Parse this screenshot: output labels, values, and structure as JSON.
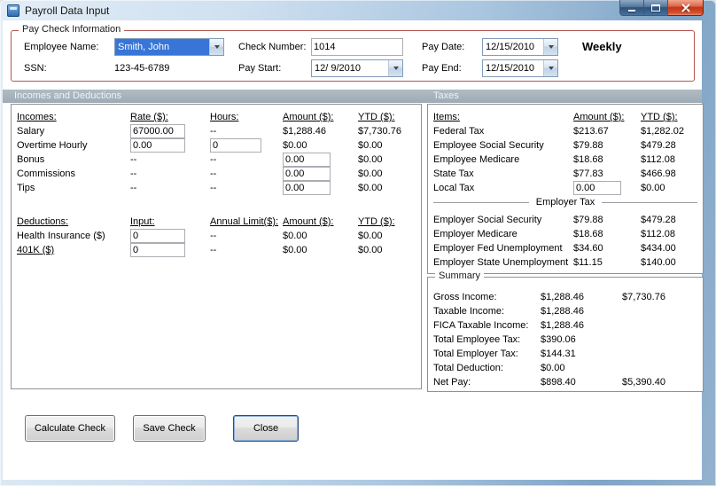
{
  "window": {
    "title": "Payroll Data Input"
  },
  "colors": {
    "group_border": "#b25653",
    "selection_blue": "#3875d7",
    "section_bar": "#a5b1ba",
    "close_button_red": "#c23516"
  },
  "header": {
    "group_title": "Pay Check Information",
    "fields": {
      "employee_name": {
        "label": "Employee Name:",
        "value": "Smith, John"
      },
      "ssn": {
        "label": "SSN:",
        "value": "123-45-6789"
      },
      "check_number": {
        "label": "Check Number:",
        "value": "1014"
      },
      "pay_start": {
        "label": "Pay Start:",
        "value": "12/ 9/2010"
      },
      "pay_date": {
        "label": "Pay Date:",
        "value": "12/15/2010"
      },
      "pay_end": {
        "label": "Pay End:",
        "value": "12/15/2010"
      }
    },
    "frequency": "Weekly"
  },
  "sections": {
    "incomes_deductions": "Incomes and Deductions",
    "taxes": "Taxes"
  },
  "incomes": {
    "headers": {
      "c0": "Incomes:",
      "c1": "Rate ($):",
      "c2": "Hours:",
      "c3": "Amount ($):",
      "c4": "YTD ($):"
    },
    "rows": [
      {
        "label": "Salary",
        "rate": "67000.00",
        "hours": "--",
        "amount": "$1,288.46",
        "ytd": "$7,730.76"
      },
      {
        "label": "Overtime Hourly",
        "rate": "0.00",
        "hours": "0",
        "amount": "$0.00",
        "ytd": "$0.00"
      },
      {
        "label": "Bonus",
        "rate": "--",
        "hours": "--",
        "amount": "0.00",
        "ytd": "$0.00"
      },
      {
        "label": "Commissions",
        "rate": "--",
        "hours": "--",
        "amount": "0.00",
        "ytd": "$0.00"
      },
      {
        "label": "Tips",
        "rate": "--",
        "hours": "--",
        "amount": "0.00",
        "ytd": "$0.00"
      }
    ]
  },
  "deductions": {
    "headers": {
      "c0": "Deductions:",
      "c1": "Input:",
      "c2": "Annual Limit($):",
      "c3": "Amount ($):",
      "c4": "YTD ($):"
    },
    "rows": [
      {
        "label": "Health Insurance  ($)",
        "input": "0",
        "limit": "--",
        "amount": "$0.00",
        "ytd": "$0.00"
      },
      {
        "label": "401K  ($)",
        "input": "0",
        "limit": "--",
        "amount": "$0.00",
        "ytd": "$0.00"
      }
    ]
  },
  "taxes": {
    "headers": {
      "c0": "Items:",
      "c1": "Amount ($):",
      "c2": "YTD ($):"
    },
    "employee_rows": [
      {
        "label": "Federal Tax",
        "amount": "$213.67",
        "ytd": "$1,282.02"
      },
      {
        "label": "Employee Social Security",
        "amount": "$79.88",
        "ytd": "$479.28"
      },
      {
        "label": "Employee Medicare",
        "amount": "$18.68",
        "ytd": "$112.08"
      },
      {
        "label": "State Tax",
        "amount": "$77.83",
        "ytd": "$466.98"
      },
      {
        "label": "Local Tax",
        "amount": "0.00",
        "ytd": "$0.00"
      }
    ],
    "employer_header": "Employer Tax",
    "employer_rows": [
      {
        "label": "Employer Social Security",
        "amount": "$79.88",
        "ytd": "$479.28"
      },
      {
        "label": "Employer Medicare",
        "amount": "$18.68",
        "ytd": "$112.08"
      },
      {
        "label": "Employer Fed Unemployment",
        "amount": "$34.60",
        "ytd": "$434.00"
      },
      {
        "label": "Employer State Unemployment",
        "amount": "$11.15",
        "ytd": "$140.00"
      }
    ]
  },
  "summary": {
    "title": "Summary",
    "rows": [
      {
        "label": "Gross Income:",
        "amount": "$1,288.46",
        "ytd": "$7,730.76"
      },
      {
        "label": "Taxable Income:",
        "amount": "$1,288.46",
        "ytd": ""
      },
      {
        "label": "FICA Taxable Income:",
        "amount": "$1,288.46",
        "ytd": ""
      },
      {
        "label": "Total Employee Tax:",
        "amount": "$390.06",
        "ytd": ""
      },
      {
        "label": "Total Employer Tax:",
        "amount": "$144.31",
        "ytd": ""
      },
      {
        "label": "Total Deduction:",
        "amount": "$0.00",
        "ytd": ""
      },
      {
        "label": "Net Pay:",
        "amount": "$898.40",
        "ytd": "$5,390.40"
      }
    ]
  },
  "buttons": {
    "calculate": "Calculate Check",
    "save": "Save Check",
    "close": "Close"
  }
}
